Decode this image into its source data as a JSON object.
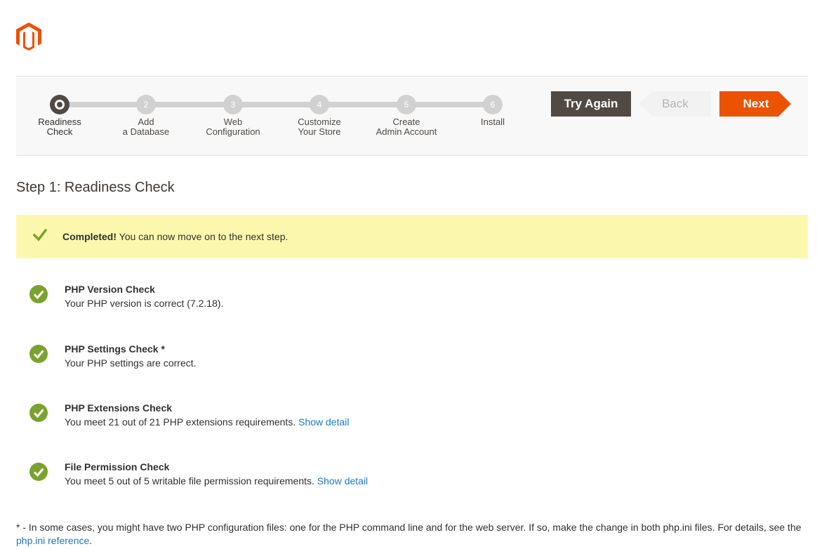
{
  "brand": {
    "logo_icon": "magento-logo-icon",
    "color": "#eb5202"
  },
  "wizard": {
    "steps": [
      {
        "number": "",
        "label": "Readiness\nCheck",
        "state": "active"
      },
      {
        "number": "2",
        "label": "Add\na Database",
        "state": "pending"
      },
      {
        "number": "3",
        "label": "Web\nConfiguration",
        "state": "pending"
      },
      {
        "number": "4",
        "label": "Customize\nYour Store",
        "state": "pending"
      },
      {
        "number": "5",
        "label": "Create\nAdmin Account",
        "state": "pending"
      },
      {
        "number": "6",
        "label": "Install",
        "state": "pending"
      }
    ],
    "progress_fraction": 0,
    "buttons": {
      "try_again": "Try Again",
      "back": "Back",
      "next": "Next"
    }
  },
  "page": {
    "title": "Step 1: Readiness Check"
  },
  "notice": {
    "strong": "Completed!",
    "text": " You can now move on to the next step.",
    "icon": "checkmark-icon"
  },
  "checks": [
    {
      "title": "PHP Version Check",
      "desc": "Your PHP version is correct (7.2.18).",
      "link": ""
    },
    {
      "title": "PHP Settings Check *",
      "desc": "Your PHP settings are correct.",
      "link": ""
    },
    {
      "title": "PHP Extensions Check",
      "desc": "You meet 21 out of 21 PHP extensions requirements. ",
      "link": "Show detail"
    },
    {
      "title": "File Permission Check",
      "desc": "You meet 5 out of 5 writable file permission requirements. ",
      "link": "Show detail"
    }
  ],
  "footnote": {
    "text": "* - In some cases, you might have two PHP configuration files: one for the PHP command line and for the web server. If so, make the change in both php.ini files. For details, see the ",
    "link": "php.ini reference",
    "after": "."
  },
  "colors": {
    "success": "#79a22e",
    "accent": "#eb5202",
    "dark": "#514943",
    "notice_bg": "#fbf8ae",
    "link": "#1979c3"
  }
}
